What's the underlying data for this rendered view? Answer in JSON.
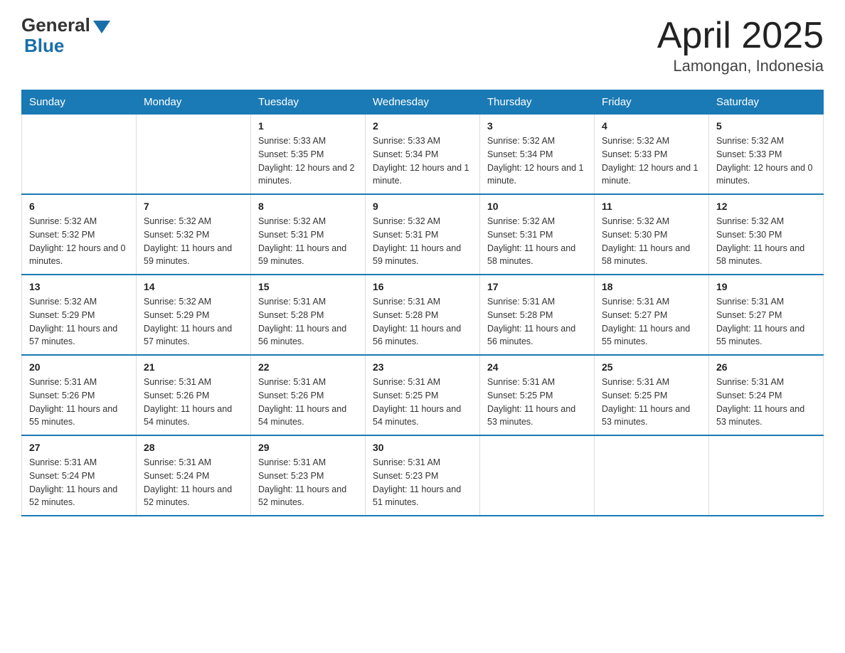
{
  "header": {
    "logo_general": "General",
    "logo_blue": "Blue",
    "title": "April 2025",
    "subtitle": "Lamongan, Indonesia"
  },
  "weekdays": [
    "Sunday",
    "Monday",
    "Tuesday",
    "Wednesday",
    "Thursday",
    "Friday",
    "Saturday"
  ],
  "weeks": [
    [
      {
        "day": "",
        "info": ""
      },
      {
        "day": "",
        "info": ""
      },
      {
        "day": "1",
        "info": "Sunrise: 5:33 AM\nSunset: 5:35 PM\nDaylight: 12 hours\nand 2 minutes."
      },
      {
        "day": "2",
        "info": "Sunrise: 5:33 AM\nSunset: 5:34 PM\nDaylight: 12 hours\nand 1 minute."
      },
      {
        "day": "3",
        "info": "Sunrise: 5:32 AM\nSunset: 5:34 PM\nDaylight: 12 hours\nand 1 minute."
      },
      {
        "day": "4",
        "info": "Sunrise: 5:32 AM\nSunset: 5:33 PM\nDaylight: 12 hours\nand 1 minute."
      },
      {
        "day": "5",
        "info": "Sunrise: 5:32 AM\nSunset: 5:33 PM\nDaylight: 12 hours\nand 0 minutes."
      }
    ],
    [
      {
        "day": "6",
        "info": "Sunrise: 5:32 AM\nSunset: 5:32 PM\nDaylight: 12 hours\nand 0 minutes."
      },
      {
        "day": "7",
        "info": "Sunrise: 5:32 AM\nSunset: 5:32 PM\nDaylight: 11 hours\nand 59 minutes."
      },
      {
        "day": "8",
        "info": "Sunrise: 5:32 AM\nSunset: 5:31 PM\nDaylight: 11 hours\nand 59 minutes."
      },
      {
        "day": "9",
        "info": "Sunrise: 5:32 AM\nSunset: 5:31 PM\nDaylight: 11 hours\nand 59 minutes."
      },
      {
        "day": "10",
        "info": "Sunrise: 5:32 AM\nSunset: 5:31 PM\nDaylight: 11 hours\nand 58 minutes."
      },
      {
        "day": "11",
        "info": "Sunrise: 5:32 AM\nSunset: 5:30 PM\nDaylight: 11 hours\nand 58 minutes."
      },
      {
        "day": "12",
        "info": "Sunrise: 5:32 AM\nSunset: 5:30 PM\nDaylight: 11 hours\nand 58 minutes."
      }
    ],
    [
      {
        "day": "13",
        "info": "Sunrise: 5:32 AM\nSunset: 5:29 PM\nDaylight: 11 hours\nand 57 minutes."
      },
      {
        "day": "14",
        "info": "Sunrise: 5:32 AM\nSunset: 5:29 PM\nDaylight: 11 hours\nand 57 minutes."
      },
      {
        "day": "15",
        "info": "Sunrise: 5:31 AM\nSunset: 5:28 PM\nDaylight: 11 hours\nand 56 minutes."
      },
      {
        "day": "16",
        "info": "Sunrise: 5:31 AM\nSunset: 5:28 PM\nDaylight: 11 hours\nand 56 minutes."
      },
      {
        "day": "17",
        "info": "Sunrise: 5:31 AM\nSunset: 5:28 PM\nDaylight: 11 hours\nand 56 minutes."
      },
      {
        "day": "18",
        "info": "Sunrise: 5:31 AM\nSunset: 5:27 PM\nDaylight: 11 hours\nand 55 minutes."
      },
      {
        "day": "19",
        "info": "Sunrise: 5:31 AM\nSunset: 5:27 PM\nDaylight: 11 hours\nand 55 minutes."
      }
    ],
    [
      {
        "day": "20",
        "info": "Sunrise: 5:31 AM\nSunset: 5:26 PM\nDaylight: 11 hours\nand 55 minutes."
      },
      {
        "day": "21",
        "info": "Sunrise: 5:31 AM\nSunset: 5:26 PM\nDaylight: 11 hours\nand 54 minutes."
      },
      {
        "day": "22",
        "info": "Sunrise: 5:31 AM\nSunset: 5:26 PM\nDaylight: 11 hours\nand 54 minutes."
      },
      {
        "day": "23",
        "info": "Sunrise: 5:31 AM\nSunset: 5:25 PM\nDaylight: 11 hours\nand 54 minutes."
      },
      {
        "day": "24",
        "info": "Sunrise: 5:31 AM\nSunset: 5:25 PM\nDaylight: 11 hours\nand 53 minutes."
      },
      {
        "day": "25",
        "info": "Sunrise: 5:31 AM\nSunset: 5:25 PM\nDaylight: 11 hours\nand 53 minutes."
      },
      {
        "day": "26",
        "info": "Sunrise: 5:31 AM\nSunset: 5:24 PM\nDaylight: 11 hours\nand 53 minutes."
      }
    ],
    [
      {
        "day": "27",
        "info": "Sunrise: 5:31 AM\nSunset: 5:24 PM\nDaylight: 11 hours\nand 52 minutes."
      },
      {
        "day": "28",
        "info": "Sunrise: 5:31 AM\nSunset: 5:24 PM\nDaylight: 11 hours\nand 52 minutes."
      },
      {
        "day": "29",
        "info": "Sunrise: 5:31 AM\nSunset: 5:23 PM\nDaylight: 11 hours\nand 52 minutes."
      },
      {
        "day": "30",
        "info": "Sunrise: 5:31 AM\nSunset: 5:23 PM\nDaylight: 11 hours\nand 51 minutes."
      },
      {
        "day": "",
        "info": ""
      },
      {
        "day": "",
        "info": ""
      },
      {
        "day": "",
        "info": ""
      }
    ]
  ]
}
